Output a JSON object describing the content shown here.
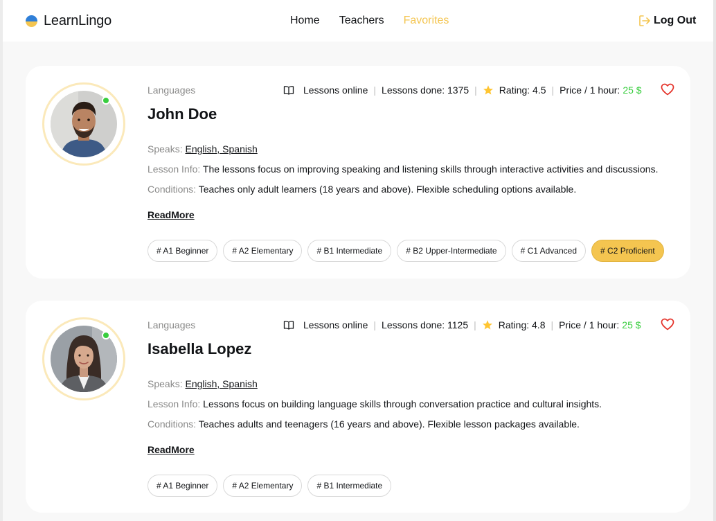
{
  "app": {
    "logo_text": "LearnLingo",
    "flag_colors": {
      "top": "#2f7fd8",
      "bottom": "#f4c550"
    }
  },
  "nav": {
    "items": [
      {
        "label": "Home"
      },
      {
        "label": "Teachers"
      },
      {
        "label": "Favorites"
      }
    ],
    "active": "Favorites",
    "logout_label": "Log Out"
  },
  "colors": {
    "accent": "#f4c550",
    "price_green": "#38cd3e",
    "heart_red": "#e5332a",
    "online": "#38cd3e"
  },
  "teachers": [
    {
      "languages_label": "Languages",
      "name": "John Doe",
      "lessons_online": "Lessons online",
      "lessons_done": "Lessons done: 1375",
      "rating": "Rating: 4.5",
      "price_label": "Price / 1 hour:",
      "price_value": "25 $",
      "speaks_label": "Speaks:",
      "speaks_value": "English, Spanish",
      "lesson_info_label": "Lesson Info:",
      "lesson_info_value": "The lessons focus on improving speaking and listening skills through interactive activities and discussions.",
      "conditions_label": "Conditions:",
      "conditions_value": "Teaches only adult learners (18 years and above). Flexible scheduling options available.",
      "read_more": "ReadMore",
      "levels": [
        "# A1 Beginner",
        "# A2 Elementary",
        "# B1 Intermediate",
        "# B2 Upper-Intermediate",
        "# C1 Advanced",
        "# C2 Proficient"
      ],
      "active_level": "# C2 Proficient",
      "favorite": true
    },
    {
      "languages_label": "Languages",
      "name": "Isabella Lopez",
      "lessons_online": "Lessons online",
      "lessons_done": "Lessons done: 1125",
      "rating": "Rating: 4.8",
      "price_label": "Price / 1 hour:",
      "price_value": "25 $",
      "speaks_label": "Speaks:",
      "speaks_value": "English, Spanish",
      "lesson_info_label": "Lesson Info:",
      "lesson_info_value": "Lessons focus on building language skills through conversation practice and cultural insights.",
      "conditions_label": "Conditions:",
      "conditions_value": "Teaches adults and teenagers (16 years and above). Flexible lesson packages available.",
      "read_more": "ReadMore",
      "levels": [
        "# A1 Beginner",
        "# A2 Elementary",
        "# B1 Intermediate"
      ],
      "active_level": null,
      "favorite": true
    }
  ]
}
